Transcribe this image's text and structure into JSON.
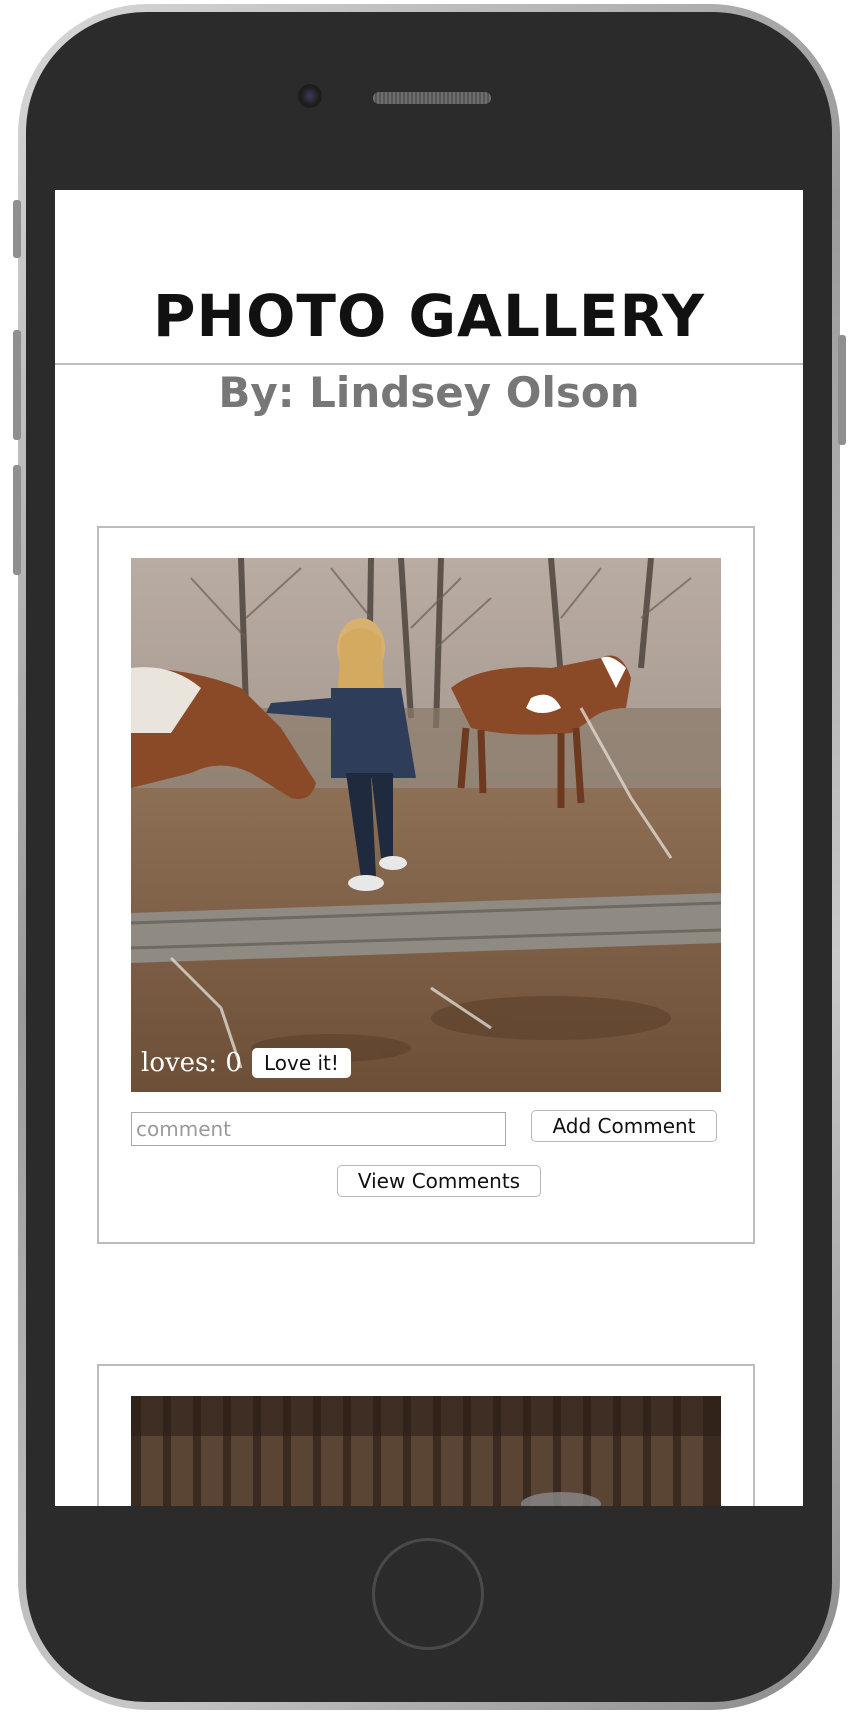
{
  "page": {
    "title": "PHOTO GALLERY",
    "subtitle": "By: Lindsey Olson"
  },
  "photos": [
    {
      "image": "woman-with-horses-photo",
      "loves_label": "loves: 0",
      "love_button": "Love it!",
      "comment_placeholder": "comment",
      "add_comment_button": "Add Comment",
      "view_comments_button": "View Comments"
    },
    {
      "image": "wooden-fence-photo"
    }
  ],
  "colors": {
    "title": "#111111",
    "subtitle": "#777777",
    "card_border": "#bdbdbd",
    "phone_body": "#2b2b2b"
  }
}
